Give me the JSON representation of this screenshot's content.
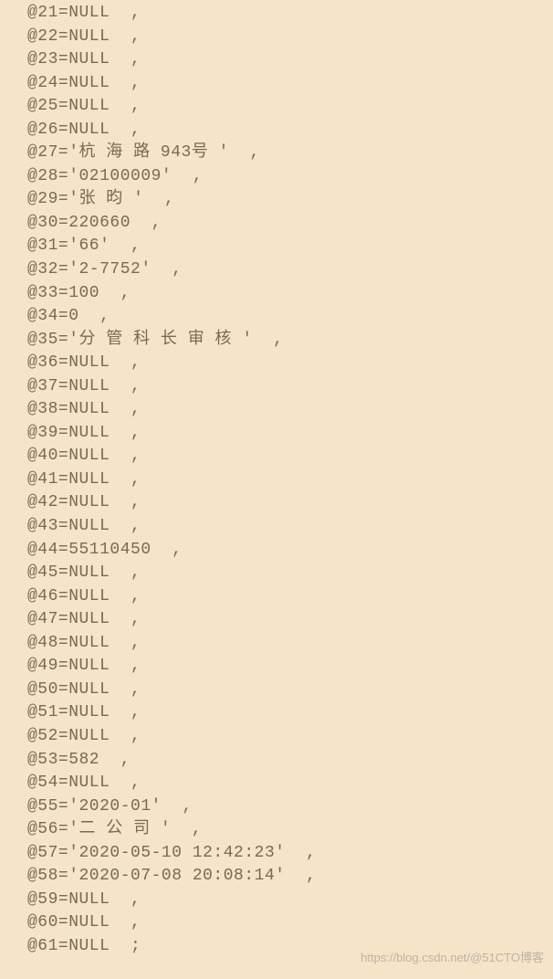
{
  "lines": [
    "@21=NULL  ,",
    "@22=NULL  ,",
    "@23=NULL  ,",
    "@24=NULL  ,",
    "@25=NULL  ,",
    "@26=NULL  ,",
    "@27='杭 海 路 943号 '  ,",
    "@28='02100009'  ,",
    "@29='张 昀 '  ,",
    "@30=220660  ,",
    "@31='66'  ,",
    "@32='2-7752'  ,",
    "@33=100  ,",
    "@34=0  ,",
    "@35='分 管 科 长 审 核 '  ,",
    "@36=NULL  ,",
    "@37=NULL  ,",
    "@38=NULL  ,",
    "@39=NULL  ,",
    "@40=NULL  ,",
    "@41=NULL  ,",
    "@42=NULL  ,",
    "@43=NULL  ,",
    "@44=55110450  ,",
    "@45=NULL  ,",
    "@46=NULL  ,",
    "@47=NULL  ,",
    "@48=NULL  ,",
    "@49=NULL  ,",
    "@50=NULL  ,",
    "@51=NULL  ,",
    "@52=NULL  ,",
    "@53=582  ,",
    "@54=NULL  ,",
    "@55='2020-01'  ,",
    "@56='二 公 司 '  ,",
    "@57='2020-05-10 12:42:23'  ,",
    "@58='2020-07-08 20:08:14'  ,",
    "@59=NULL  ,",
    "@60=NULL  ,",
    "@61=NULL  ;"
  ],
  "watermark": "https://blog.csdn.net/@51CTO博客"
}
